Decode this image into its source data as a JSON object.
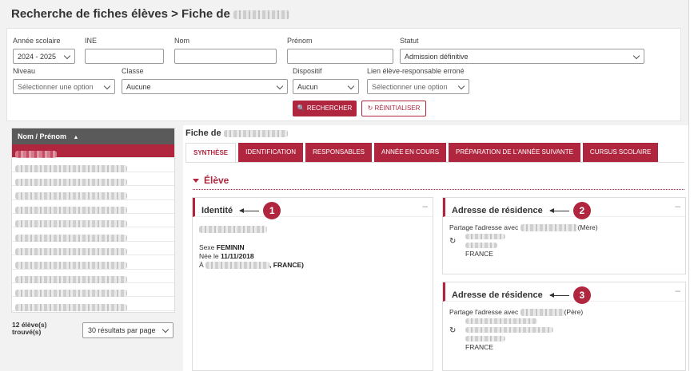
{
  "page": {
    "title": "Recherche de fiches élèves > Fiche de"
  },
  "filters": {
    "annee_label": "Année scolaire",
    "annee_value": "2024 - 2025",
    "ine_label": "INE",
    "ine_value": "",
    "nom_label": "Nom",
    "nom_value": "",
    "prenom_label": "Prénom",
    "prenom_value": "",
    "statut_label": "Statut",
    "statut_value": "Admission définitive",
    "niveau_label": "Niveau",
    "niveau_placeholder": "Sélectionner une option",
    "classe_label": "Classe",
    "classe_value": "Aucune",
    "dispositif_label": "Dispositif",
    "dispositif_value": "Aucun",
    "lien_label": "Lien élève-responsable erroné",
    "lien_placeholder": "Sélectionner une option",
    "search_label": "RECHERCHER",
    "reset_label": "RÉINITIALISER"
  },
  "results": {
    "column_header": "Nom / Prénom",
    "count_line1": "12 élève(s)",
    "count_line2": "trouvé(s)",
    "per_page": "30 résultats par page"
  },
  "fiche": {
    "label": "Fiche de",
    "tabs": [
      "SYNTHÈSE",
      "IDENTIFICATION",
      "RESPONSABLES",
      "ANNÉE EN COURS",
      "PRÉPARATION DE L'ANNÉE SUIVANTE",
      "CURSUS SCOLAIRE"
    ],
    "section": "Élève"
  },
  "identite": {
    "title": "Identité",
    "callout": "1",
    "sexe_label": "Sexe",
    "sexe_value": "FEMININ",
    "naissance_label": "Née le",
    "naissance_value": "11/11/2018",
    "lieu_prefix": "À",
    "lieu_suffix": ", FRANCE)"
  },
  "adresse1": {
    "title": "Adresse de résidence",
    "callout": "2",
    "partage_prefix": "Partage l'adresse avec",
    "partage_suffix": "(Mère)",
    "pays": "FRANCE"
  },
  "adresse2": {
    "title": "Adresse de résidence",
    "callout": "3",
    "partage_prefix": "Partage l'adresse avec",
    "partage_suffix": "(Père)",
    "pays": "FRANCE"
  },
  "icons": {
    "search": "search-icon",
    "reset": "reset-icon",
    "sort": "sort-up-icon",
    "refresh": "refresh-icon"
  },
  "colors": {
    "accent": "#b0263f",
    "header_dark": "#5a5a5a"
  }
}
